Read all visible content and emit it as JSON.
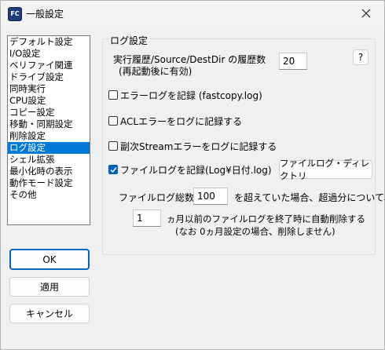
{
  "window": {
    "title": "一般設定",
    "app_icon_text": "FC"
  },
  "sidebar": {
    "items": [
      {
        "label": "デフォルト設定"
      },
      {
        "label": "I/O設定"
      },
      {
        "label": "ベリファイ関連"
      },
      {
        "label": "ドライブ設定"
      },
      {
        "label": "同時実行"
      },
      {
        "label": "CPU設定"
      },
      {
        "label": "コピー設定"
      },
      {
        "label": "移動・同期設定"
      },
      {
        "label": "削除設定"
      },
      {
        "label": "ログ設定"
      },
      {
        "label": "シェル拡張"
      },
      {
        "label": "最小化時の表示"
      },
      {
        "label": "動作モード設定"
      },
      {
        "label": "その他"
      }
    ],
    "selected_index": 9
  },
  "buttons": {
    "ok": "OK",
    "apply": "適用",
    "cancel": "キャンセル"
  },
  "log_settings": {
    "group_label": "ログ設定",
    "history_label_1": "実行履歴/Source/DestDir の履歴数",
    "history_label_2": "(再起動後に有効)",
    "history_value": "20",
    "help_button": "?",
    "error_log_label": "エラーログを記録 (fastcopy.log)",
    "error_log_checked": false,
    "acl_label": "ACLエラーをログに記録する",
    "acl_checked": false,
    "stream_label": "副次Streamエラーをログに記録する",
    "stream_checked": false,
    "file_log_label": "ファイルログを記録(Log¥日付.log)",
    "file_log_checked": true,
    "file_log_dir_button": "ファイルログ・ディレクトリ",
    "total_label": "ファイルログ総数が",
    "total_value": "100",
    "total_suffix": "を超えていた場合、超過分について、",
    "months_value": "1",
    "months_label": "ヵ月以前のファイルログを終了時に自動削除する",
    "months_note": "(なお 0ヵ月設定の場合、削除しません)"
  },
  "colors": {
    "selection": "#0078d7",
    "checkbox_checked": "#005fb8"
  }
}
